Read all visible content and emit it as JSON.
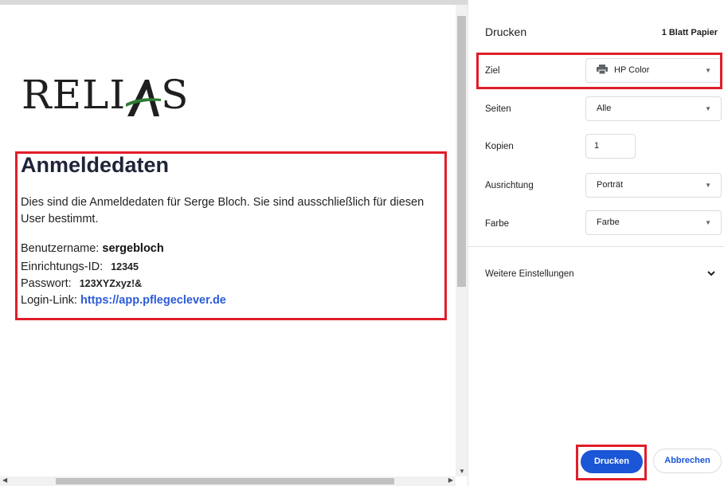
{
  "document": {
    "logo_text": "RELIAS",
    "title": "Anmeldedaten",
    "intro": "Dies sind die Anmeldedaten für Serge Bloch. Sie sind ausschließlich für diesen User bestimmt.",
    "username_label": "Benutzername:",
    "username_value": "sergebloch",
    "facility_label": "Einrichtungs-ID:",
    "facility_value": "12345",
    "password_label": "Passwort:",
    "password_value": "123XYZxyz!&",
    "login_label": "Login-Link:",
    "login_value": "https://app.pflegeclever.de"
  },
  "print_panel": {
    "title": "Drucken",
    "sheets": "1 Blatt Papier",
    "destination_label": "Ziel",
    "destination_value": "HP Color",
    "pages_label": "Seiten",
    "pages_value": "Alle",
    "copies_label": "Kopien",
    "copies_value": "1",
    "orientation_label": "Ausrichtung",
    "orientation_value": "Porträt",
    "color_label": "Farbe",
    "color_value": "Farbe",
    "more_settings": "Weitere Einstellungen",
    "print_button": "Drucken",
    "cancel_button": "Abbrechen"
  },
  "colors": {
    "highlight": "#e01e2a",
    "primary_button": "#1a56d6",
    "link": "#2b5bd7",
    "logo_accent": "#2e7d32"
  }
}
